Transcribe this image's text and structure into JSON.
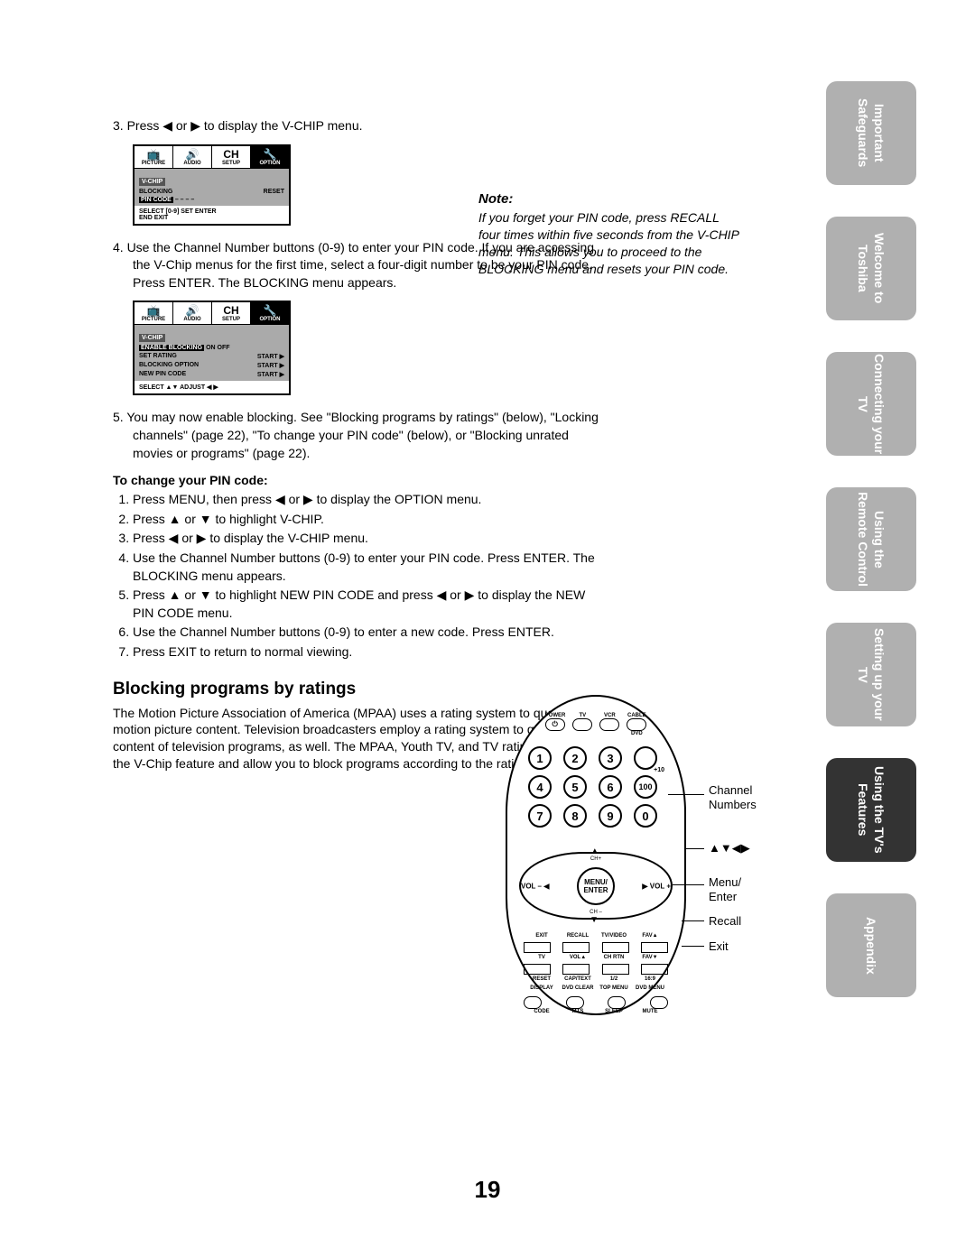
{
  "page_number": "19",
  "side_tabs": [
    "Important\nSafeguards",
    "Welcome to\nToshiba",
    "Connecting\nyour TV",
    "Using the\nRemote Control",
    "Setting up\nyour TV",
    "Using the TV's\nFeatures",
    "Appendix"
  ],
  "active_side_tab": 5,
  "step3": "3. Press ◀ or ▶ to display the V-CHIP menu.",
  "osd1": {
    "tabs": [
      "PICTURE",
      "AUDIO",
      "SETUP",
      "OPTION"
    ],
    "header": "V-CHIP",
    "rows": [
      {
        "label": "BLOCKING",
        "value": "RESET"
      },
      {
        "label": "PIN CODE",
        "value": "– – – –",
        "highlight": true
      }
    ],
    "footer": [
      "SELECT",
      "[0-9]",
      "SET",
      "ENTER",
      "END",
      "EXIT"
    ],
    "foot_display": {
      "l1": "SELECT   [0-9]   SET          ENTER",
      "l2": "END       EXIT"
    }
  },
  "step4": "4. Use the Channel Number buttons (0-9) to enter your PIN code. If you are accessing the V-Chip menus for the first time, select a four-digit number to be your PIN code. Press ENTER. The BLOCKING menu appears.",
  "osd2": {
    "tabs": [
      "PICTURE",
      "AUDIO",
      "SETUP",
      "OPTION"
    ],
    "header": "V-CHIP",
    "rows": [
      {
        "highlight_label": "ENABLE BLOCKING",
        "post": "ON OFF"
      },
      {
        "label": "SET RATING",
        "value": "START ▶"
      },
      {
        "label": "BLOCKING OPTION",
        "value": "START ▶"
      },
      {
        "label": "NEW PIN CODE",
        "value": "START ▶"
      }
    ],
    "foot_display": "SELECT   ▲▼     ADJUST     ◀ ▶"
  },
  "step5": "5. You may now enable blocking. See \"Blocking programs by ratings\" (below), \"Locking channels\" (page 22), \"To change your PIN code\" (below), or \"Blocking unrated movies or programs\" (page 22).",
  "change_pin_head": "To change your PIN code:",
  "change_pin_steps": [
    "Press MENU, then press ◀ or ▶ to display the OPTION menu.",
    "Press ▲ or ▼ to highlight V-CHIP.",
    "Press ◀ or ▶ to display the V-CHIP menu.",
    "Use the Channel Number buttons (0-9) to enter your PIN code. Press ENTER. The BLOCKING menu appears.",
    "Press ▲ or ▼ to highlight NEW PIN CODE and press ◀ or ▶ to display the NEW PIN CODE menu.",
    "Use the Channel Number buttons (0-9) to enter a new code. Press ENTER.",
    "Press EXIT to return to normal viewing."
  ],
  "section_head": "Blocking programs by ratings",
  "section_body": "The Motion Picture Association of America (MPAA) uses a rating system to qualify motion picture content. Television broadcasters employ a rating system to qualify the content of television programs, as well. The MPAA, Youth TV, and TV ratings work with the V-Chip feature and allow you to block programs according to the rating limits you set.",
  "note_title": "Note:",
  "note_body": "If you forget your PIN code, press RECALL four times within five seconds from the V-CHIP menu. This allows you to proceed to the BLOCKING menu and resets your PIN code.",
  "remote": {
    "top_labels": [
      "POWER",
      "TV",
      "VCR",
      "CABLE",
      "DVD"
    ],
    "numbers": [
      "1",
      "2",
      "3",
      "",
      "4",
      "5",
      "6",
      "100",
      "7",
      "8",
      "9",
      "0"
    ],
    "plus10": "+10",
    "center": "MENU/\nENTER",
    "ch_plus": "CH+",
    "ch_minus": "CH –",
    "vol_l": "VOL –",
    "vol_r": "VOL +",
    "row1": [
      "EXIT",
      "RECALL",
      "TV/VIDEO",
      "FAV▲"
    ],
    "row1b": [
      "TV",
      "VOL▲",
      "CH RTN",
      "FAV▼"
    ],
    "row2": [
      "RESET",
      "CAP/TEXT",
      "1/2",
      "16:9"
    ],
    "row3": [
      "DISPLAY",
      "DVD CLEAR",
      "TOP MENU",
      "DVD MENU"
    ],
    "row4": [
      "CODE",
      "MTS",
      "SLEEP",
      "MUTE"
    ],
    "callouts": {
      "channel": "Channel\nNumbers",
      "arrows": "▲▼◀▶",
      "menu": "Menu/\nEnter",
      "recall": "Recall",
      "exit": "Exit"
    }
  }
}
